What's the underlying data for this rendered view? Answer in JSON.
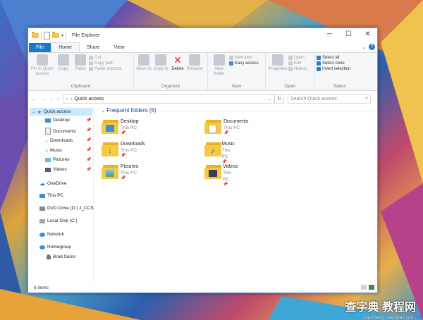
{
  "window": {
    "title": "File Explorer",
    "controls": [
      "─",
      "☐",
      "✕"
    ]
  },
  "tabs": [
    {
      "label": "File"
    },
    {
      "label": "Home"
    },
    {
      "label": "Share"
    },
    {
      "label": "View"
    }
  ],
  "help_glyph": "?",
  "ribbon": {
    "clipboard": {
      "label": "Clipboard",
      "pin": "Pin to Quick access",
      "copy": "Copy",
      "paste": "Paste",
      "cut": "Cut",
      "copy_path": "Copy path",
      "paste_shortcut": "Paste shortcut"
    },
    "organize": {
      "label": "Organize",
      "move_to": "Move to",
      "copy_to": "Copy to",
      "delete": "Delete",
      "rename": "Rename"
    },
    "new": {
      "label": "New",
      "new_folder": "New folder",
      "new_item": "New item",
      "easy_access": "Easy access"
    },
    "open": {
      "label": "Open",
      "properties": "Properties",
      "open": "Open",
      "edit": "Edit",
      "history": "History"
    },
    "select": {
      "label": "Select",
      "select_all": "Select all",
      "select_none": "Select none",
      "invert": "Invert selection"
    }
  },
  "address": {
    "path": "Quick access",
    "search_placeholder": "Search Quick access"
  },
  "nav_tree": {
    "quick_access": "Quick access",
    "pinned": [
      {
        "label": "Desktop"
      },
      {
        "label": "Documents"
      },
      {
        "label": "Downloads"
      },
      {
        "label": "Music"
      },
      {
        "label": "Pictures"
      },
      {
        "label": "Videos"
      }
    ],
    "onedrive": "OneDrive",
    "this_pc": "This PC",
    "dvd": "DVD Drive (D:) J_CCS",
    "local": "Local Disk (C:)",
    "network": "Network",
    "homegroup": "Homegroup",
    "user": "Brad Sams"
  },
  "content": {
    "section": "Frequent folders (6)",
    "folders": [
      {
        "name": "Desktop",
        "loc": "This PC"
      },
      {
        "name": "Documents",
        "loc": "This PC"
      },
      {
        "name": "Downloads",
        "loc": "This PC"
      },
      {
        "name": "Music",
        "loc": "This PC"
      },
      {
        "name": "Pictures",
        "loc": "This PC"
      },
      {
        "name": "Videos",
        "loc": "This PC"
      }
    ]
  },
  "status": {
    "items": "6 items"
  },
  "watermark": {
    "main": "查字典 教程网",
    "sub": "jiaocheng.chazidian.com"
  }
}
